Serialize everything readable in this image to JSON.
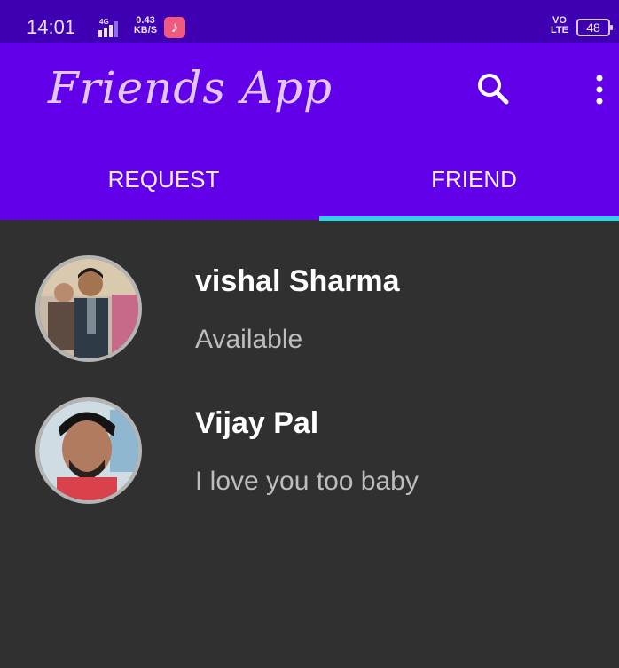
{
  "status_bar": {
    "time": "14:01",
    "network": "4G",
    "data_rate_value": "0.43",
    "data_rate_unit": "KB/S",
    "volte_top": "VO",
    "volte_bottom": "LTE",
    "battery": "48"
  },
  "app_bar": {
    "title": "Friends App",
    "search_icon": "search-icon",
    "menu_icon": "more-vert-icon"
  },
  "tabs": [
    {
      "label": "REQUEST",
      "selected": false
    },
    {
      "label": "FRIEND",
      "selected": true
    }
  ],
  "friends": [
    {
      "name": "vishal Sharma",
      "status": "Available"
    },
    {
      "name": "Vijay Pal",
      "status": "I love you too baby"
    }
  ],
  "colors": {
    "status_bar": "#3F00B3",
    "app_bar": "#6200EA",
    "tab_indicator": "#2ED3E9",
    "background": "#303030",
    "title": "#E3C8FF"
  }
}
